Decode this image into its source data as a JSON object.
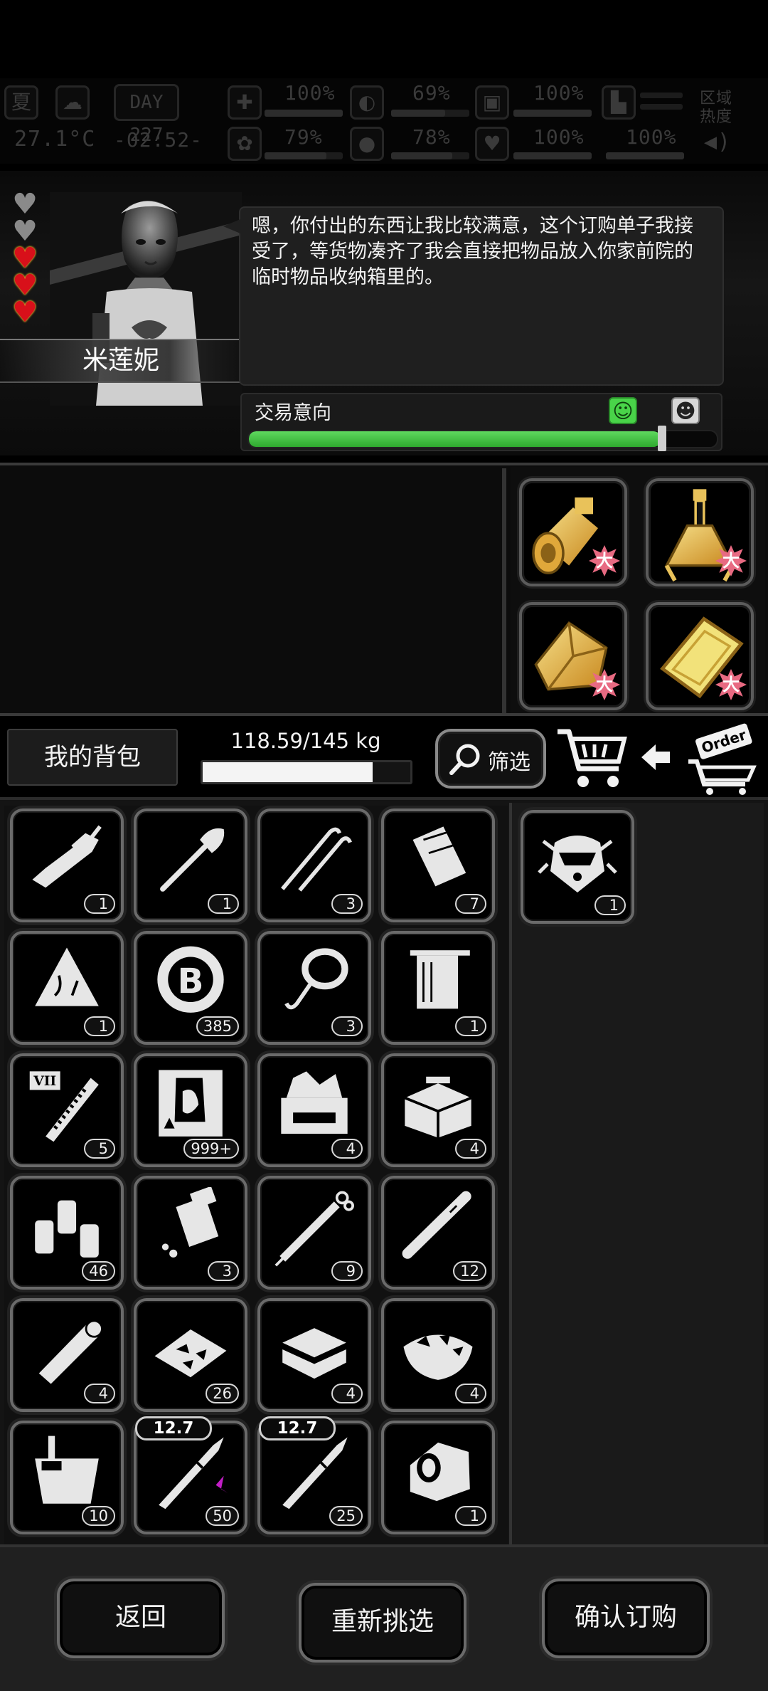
{
  "hud": {
    "season": "夏",
    "day": "DAY 227",
    "temperature": "27.1°C",
    "clock": "-02:52-",
    "health_pct": "100%",
    "hunger_pct": "69%",
    "armor_pct": "100%",
    "brain_pct": "79%",
    "water_pct": "78%",
    "heart_pct": "100%",
    "stamina_pct": "100%",
    "zone_heat_line1": "区域",
    "zone_heat_line2": "热度",
    "levels": {
      "health": 1.0,
      "hunger": 0.69,
      "armor": 1.0,
      "brain": 0.79,
      "water": 0.78,
      "heart": 1.0,
      "stamina": 1.0
    }
  },
  "npc": {
    "name": "米莲妮",
    "dialogue": "嗯，你付出的东西让我比较满意，这个订购单子我接受了，等货物凑齐了我会直接把物品放入你家前院的临时物品收纳箱里的。",
    "hearts_filled": 3,
    "hearts_total": 5,
    "willingness_label": "交易意向",
    "willingness_level": 0.88
  },
  "order_items": [
    {
      "icon": "gold-engine-icon",
      "badge": "大"
    },
    {
      "icon": "gold-flask-icon",
      "badge": "大"
    },
    {
      "icon": "gold-ore-icon",
      "badge": "大"
    },
    {
      "icon": "gold-plate-icon",
      "badge": "大"
    }
  ],
  "toolbar": {
    "my_bag_label": "我的背包",
    "weight_text": "118.59/145 kg",
    "weight_level": 0.818,
    "filter_label": "筛选",
    "order_tag": "Order"
  },
  "bag_items": [
    {
      "icon": "hacksaw-icon",
      "count": "1"
    },
    {
      "icon": "shovel-icon",
      "count": "1"
    },
    {
      "icon": "lockpick-icon",
      "count": "3"
    },
    {
      "icon": "paper-roll-icon",
      "count": "7"
    },
    {
      "icon": "cloth-scrap-icon",
      "count": "1"
    },
    {
      "icon": "bitcoin-chip-icon",
      "count": "385"
    },
    {
      "icon": "rope-hook-icon",
      "count": "3"
    },
    {
      "icon": "towel-icon",
      "count": "1"
    },
    {
      "icon": "test-tube-icon",
      "count": "5",
      "tube_label": "VII"
    },
    {
      "icon": "zombie-card-icon",
      "count": "999+"
    },
    {
      "icon": "toolbox-open-icon",
      "count": "4"
    },
    {
      "icon": "toolbox-closed-icon",
      "count": "4"
    },
    {
      "icon": "spray-cans-icon",
      "count": "46"
    },
    {
      "icon": "pill-bottle-icon",
      "count": "3"
    },
    {
      "icon": "syringe-icon",
      "count": "9"
    },
    {
      "icon": "cigarette-icon",
      "count": "12"
    },
    {
      "icon": "bandage-roll-icon",
      "count": "4"
    },
    {
      "icon": "food-tray-icon",
      "count": "26"
    },
    {
      "icon": "sandwich-icon",
      "count": "4"
    },
    {
      "icon": "salad-bowl-icon",
      "count": "4"
    },
    {
      "icon": "bucket-icon",
      "count": "10"
    },
    {
      "icon": "bullet-special-icon",
      "count": "50",
      "caliber": "12.7"
    },
    {
      "icon": "bullet-icon",
      "count": "25",
      "caliber": "12.7"
    },
    {
      "icon": "red-dot-sight-icon",
      "count": "1"
    }
  ],
  "selected_items": [
    {
      "icon": "helmet-robot-icon",
      "count": "1"
    }
  ],
  "bottom": {
    "back_label": "返回",
    "reselect_label": "重新挑选",
    "confirm_label": "确认订购"
  },
  "colors": {
    "willingness_fill": "#3fbf3f",
    "heart_full": "#d8101a",
    "badge_pink": "#e86a82",
    "gold": "#e8b84a"
  }
}
